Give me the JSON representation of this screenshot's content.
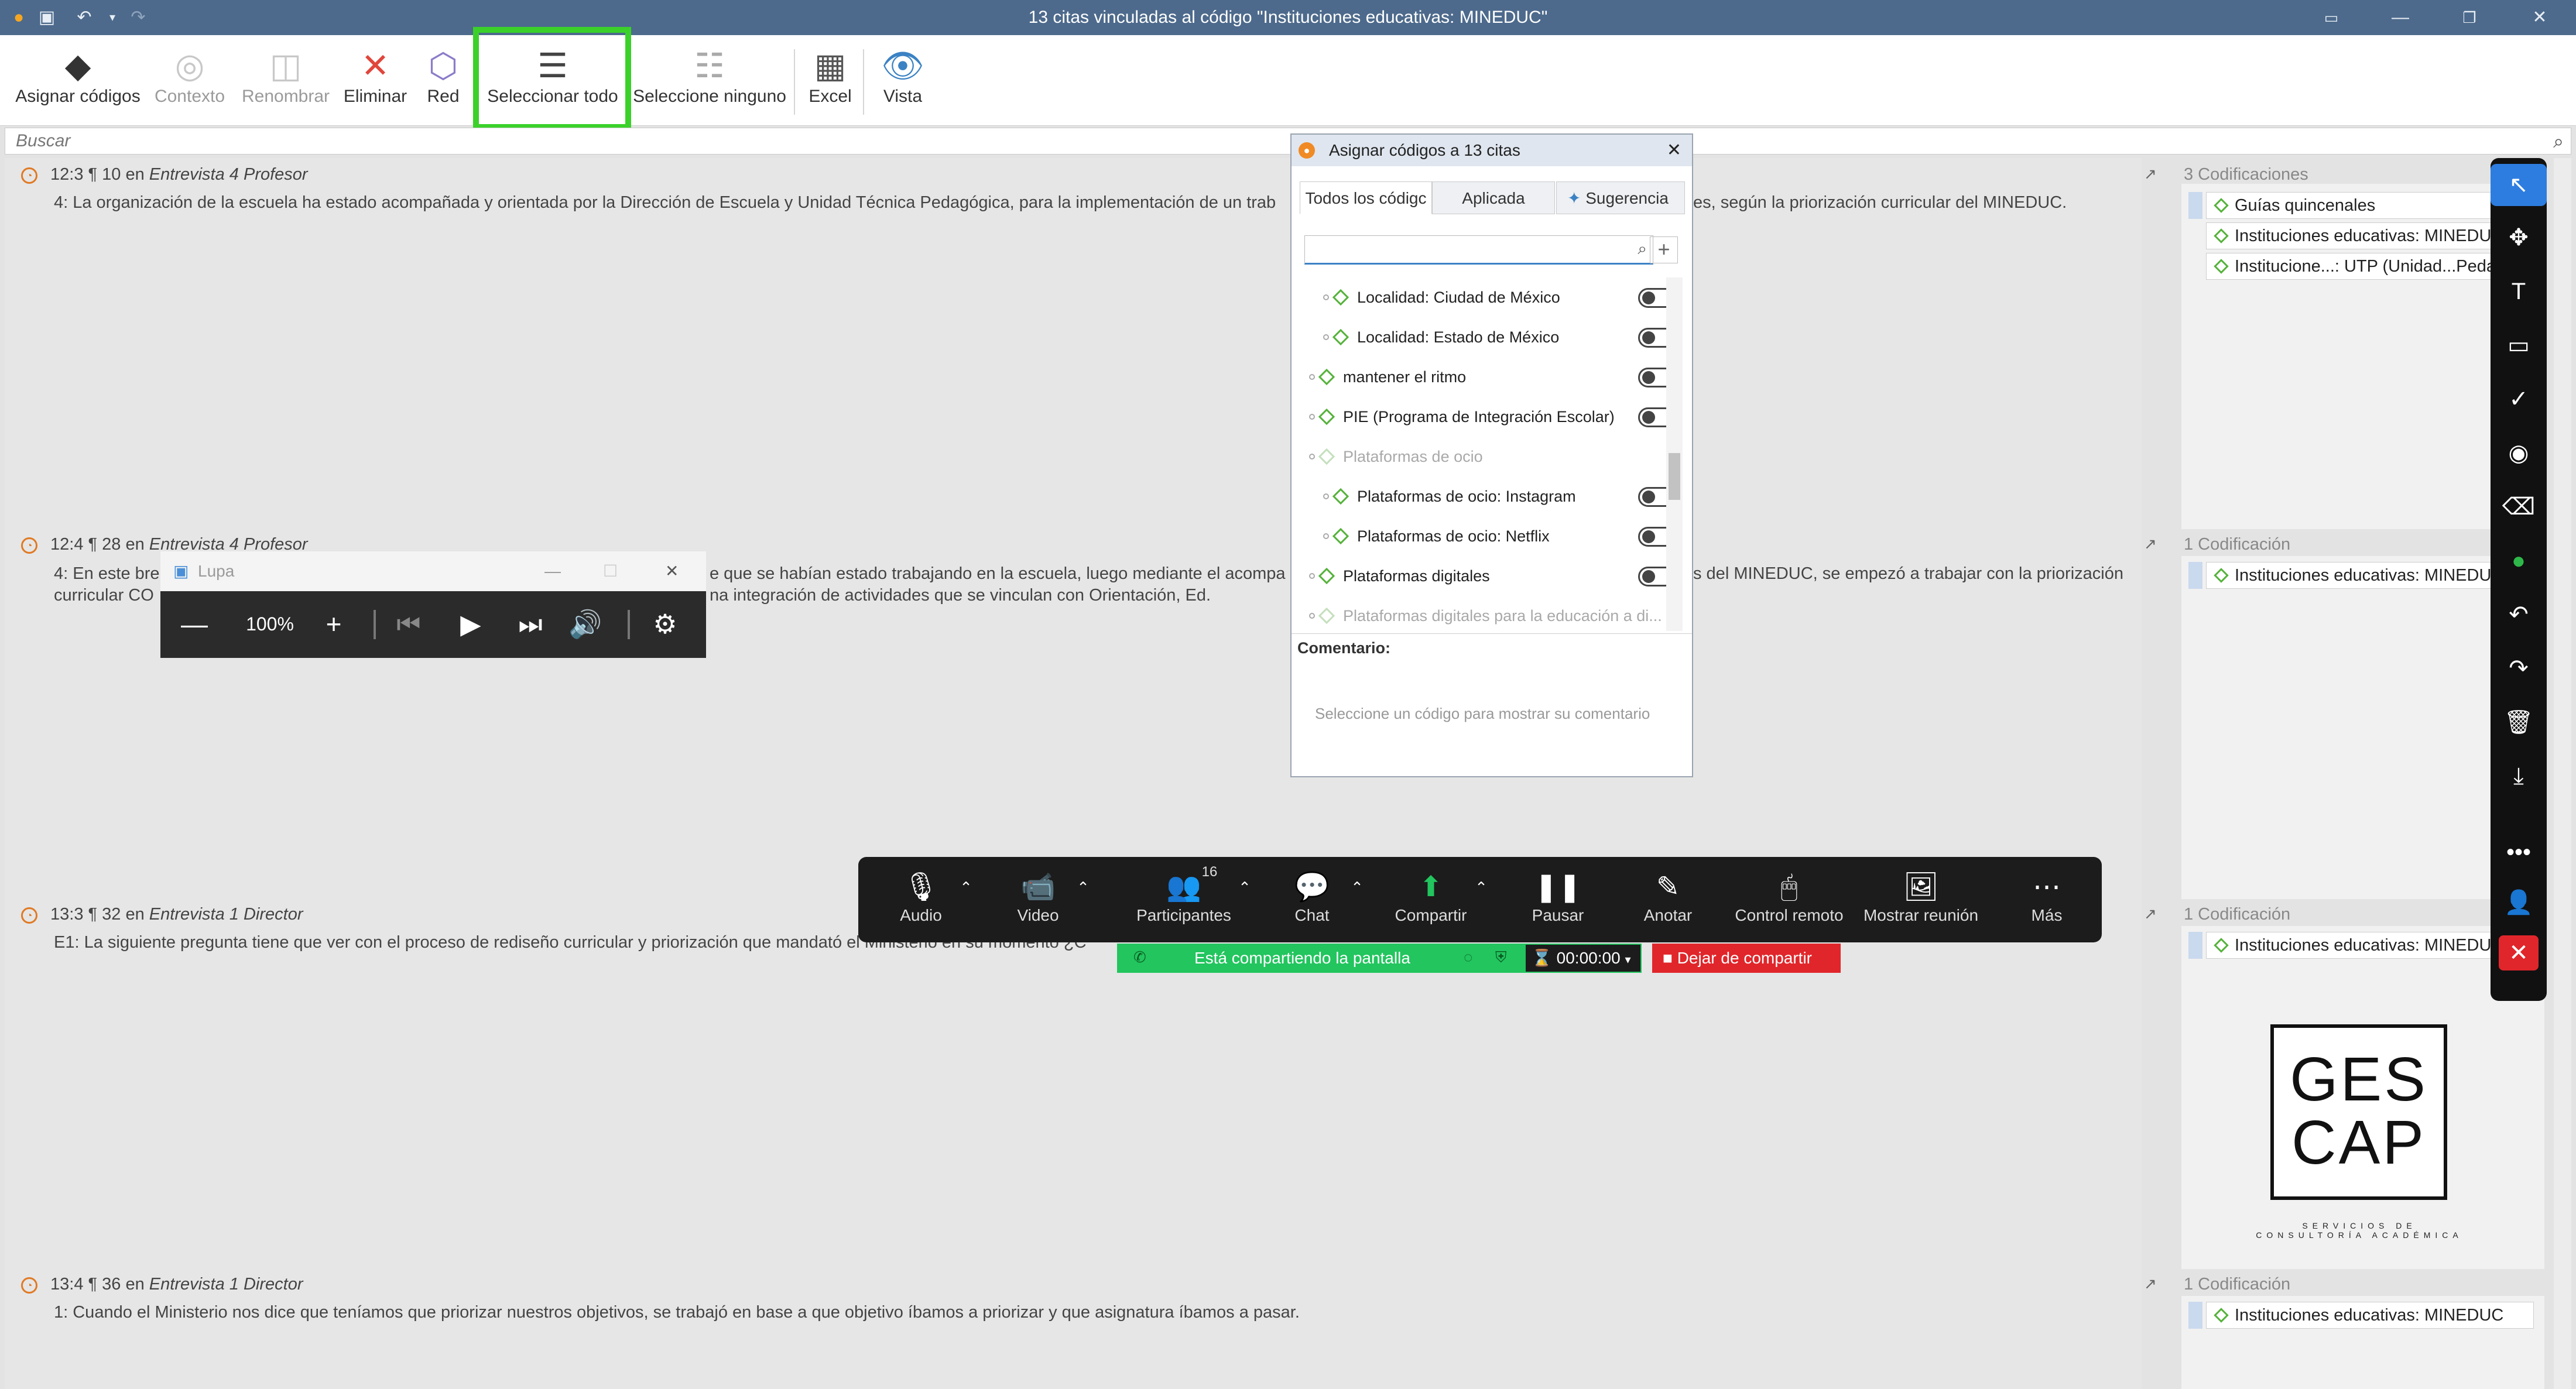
{
  "window": {
    "title": "13 citas vinculadas al código \"Instituciones educativas: MINEDUC\""
  },
  "toolbar": {
    "assign": "Asignar códigos",
    "context": "Contexto",
    "rename": "Renombrar",
    "delete": "Eliminar",
    "network": "Red",
    "select_all": "Seleccionar todo",
    "select_none": "Seleccione ninguno",
    "excel": "Excel",
    "view": "Vista"
  },
  "search": {
    "placeholder": "Buscar"
  },
  "quotes": [
    {
      "id": "12:3",
      "para": "¶ 10",
      "in": "en",
      "doc": "Entrevista 4 Profesor",
      "text": "4: La organización de la escuela ha estado acompañada y orientada por la Dirección de Escuela y Unidad Técnica Pedagógica, para la implementación de un trab",
      "text_right": "es, según la priorización curricular del MINEDUC.",
      "count": "3 Codificaciones",
      "codes": [
        "Guías quincenales",
        "Instituciones educativas: MINEDUC",
        "Institucione...: UTP (Unidad...Pedag"
      ]
    },
    {
      "id": "12:4",
      "para": "¶ 28",
      "in": "en",
      "doc": "Entrevista 4 Profesor",
      "text": "4: En este bre",
      "text2": "curricular CO",
      "text_mid1": "e que se habían estado trabajando en la escuela, luego mediante el acompa",
      "text_mid2": "na integración de actividades que se vinculan con Orientación, Ed.",
      "text_right": "s del MINEDUC, se empezó a trabajar con la priorización",
      "count": "1 Codificación",
      "codes": [
        "Instituciones educativas: MINEDUC"
      ]
    },
    {
      "id": "13:3",
      "para": "¶ 32",
      "in": "en",
      "doc": "Entrevista 1 Director",
      "text": "E1: La siguiente pregunta tiene que ver con el proceso de rediseño curricular y priorización que mandató el Ministerio en su momento ¿C",
      "count": "1 Codificación",
      "codes": [
        "Instituciones educativas: MINEDUC"
      ]
    },
    {
      "id": "13:4",
      "para": "¶ 36",
      "in": "en",
      "doc": "Entrevista 1 Director",
      "text": "1: Cuando el Ministerio nos dice que teníamos que priorizar nuestros objetivos, se trabajó en base a que objetivo íbamos a priorizar y que asignatura íbamos a pasar.",
      "count": "1 Codificación",
      "codes": [
        "Instituciones educativas: MINEDUC"
      ]
    }
  ],
  "dialog": {
    "title": "Asignar códigos a 13 citas",
    "tabs": [
      "Todos los códigc",
      "Aplicada",
      "Sugerencia"
    ],
    "codes": [
      {
        "label": "Localidad: Ciudad de México",
        "toggle": "off",
        "dim": false
      },
      {
        "label": "Localidad: Estado de México",
        "toggle": "off",
        "dim": false
      },
      {
        "label": "mantener el ritmo",
        "toggle": "off",
        "dim": false
      },
      {
        "label": "PIE (Programa de Integración Escolar)",
        "toggle": "off",
        "dim": false
      },
      {
        "label": "Plataformas de ocio",
        "toggle": "none",
        "dim": true
      },
      {
        "label": "Plataformas de ocio: Instagram",
        "toggle": "off",
        "dim": false
      },
      {
        "label": "Plataformas de ocio: Netflix",
        "toggle": "off",
        "dim": false
      },
      {
        "label": "Plataformas digitales",
        "toggle": "off",
        "dim": false
      },
      {
        "label": "Plataformas digitales para la educación a di...",
        "toggle": "none",
        "dim": true
      }
    ],
    "comment_label": "Comentario:",
    "comment_hint": "Seleccione un código para mostrar su comentario"
  },
  "lupa": {
    "title": "Lupa",
    "zoom": "100%"
  },
  "meeting": {
    "buttons": [
      "Audio",
      "Video",
      "Participantes",
      "Chat",
      "Compartir",
      "Pausar",
      "Anotar",
      "Control remoto",
      "Mostrar reunión",
      "Más"
    ],
    "participants_count": "16",
    "sharing": "Está compartiendo la pantalla",
    "timer": "00:00:00",
    "stop": "Dejar de compartir"
  },
  "logo": {
    "line1": "GES",
    "line2": "CAP",
    "tagline": "SERVICIOS DE CONSULTORÍA ACADÉMICA"
  },
  "colors": {
    "highlight": "#3bd12a",
    "titlebar": "#4d6a8c",
    "stop": "#e0262b",
    "share_green": "#22c55e"
  }
}
